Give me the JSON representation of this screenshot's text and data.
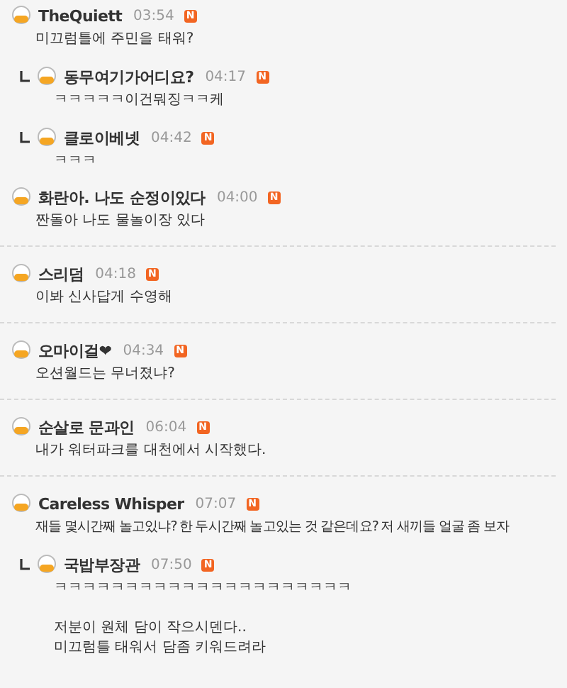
{
  "comments": [
    {
      "author": "TheQuiett",
      "time": "03:54",
      "badge": "N",
      "lines": [
        "미끄럼틀에 주민을 태워?"
      ],
      "children": [
        {
          "author": "동무여기가어디요?",
          "time": "04:17",
          "badge": "N",
          "lines": [
            "ㅋㅋㅋㅋㅋ이건뭐징ㅋㅋ케"
          ]
        },
        {
          "author": "클로이베넷",
          "time": "04:42",
          "badge": "N",
          "lines": [
            "ㅋㅋㅋ"
          ]
        }
      ]
    },
    {
      "author": "화란아. 나도 순정이있다",
      "time": "04:00",
      "badge": "N",
      "lines": [
        "짠돌아 나도 물놀이장 있다"
      ]
    },
    {
      "author": "스리덤",
      "time": "04:18",
      "badge": "N",
      "lines": [
        "이봐 신사답게 수영해"
      ]
    },
    {
      "author": "오마이걸❤",
      "time": "04:34",
      "badge": "N",
      "lines": [
        "오션월드는 무너졌냐?"
      ]
    },
    {
      "author": "순살로 문과인",
      "time": "06:04",
      "badge": "N",
      "lines": [
        "내가 워터파크를 대천에서 시작했다."
      ]
    },
    {
      "author": "Careless Whisper",
      "time": "07:07",
      "badge": "N",
      "lines": [
        "재들 몇시간째 놀고있냐? 한 두시간째 놀고있는 것 같은데요? 저 새끼들 얼굴 좀 보자"
      ],
      "children": [
        {
          "author": "국밥부장관",
          "time": "07:50",
          "badge": "N",
          "lines": [
            "ㅋㅋㅋㅋㅋㅋㅋㅋㅋㅋㅋㅋㅋㅋㅋㅋㅋㅋㅋㅋㅋ",
            "저분이 원체 담이 작으시덴다..\n미끄럼틀 태워서 담좀 키워드려라"
          ]
        }
      ]
    }
  ]
}
